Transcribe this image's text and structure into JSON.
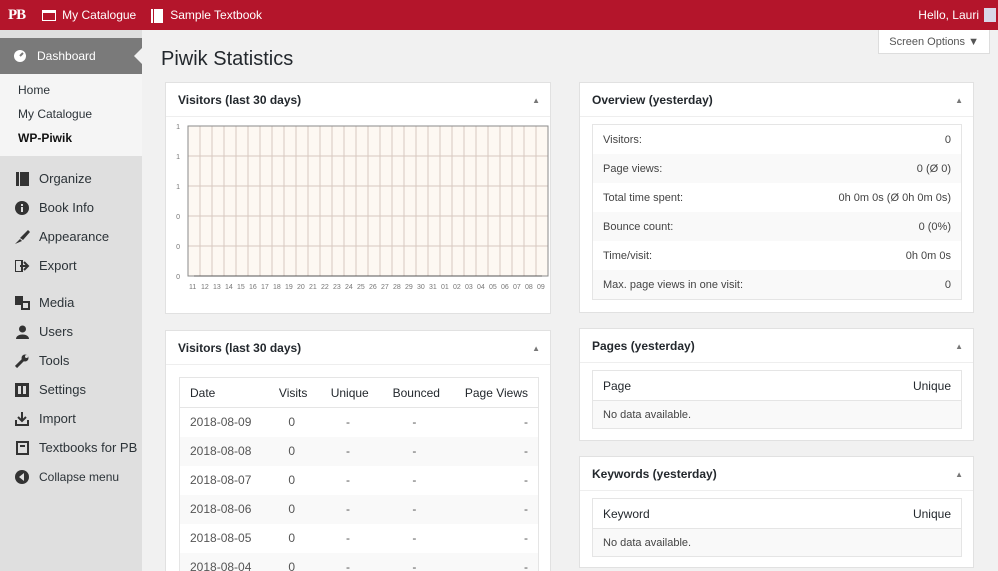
{
  "adminbar": {
    "logo": "PB",
    "catalogue": "My Catalogue",
    "book": "Sample Textbook",
    "greeting": "Hello, Lauri"
  },
  "sidebar": {
    "current": "Dashboard",
    "submenu": [
      "Home",
      "My Catalogue",
      "WP-Piwik"
    ],
    "items": [
      {
        "label": "Organize",
        "icon": "organize-icon"
      },
      {
        "label": "Book Info",
        "icon": "info-icon"
      },
      {
        "label": "Appearance",
        "icon": "appearance-icon"
      },
      {
        "label": "Export",
        "icon": "export-icon"
      },
      {
        "label": "Media",
        "icon": "media-icon"
      },
      {
        "label": "Users",
        "icon": "users-icon"
      },
      {
        "label": "Tools",
        "icon": "tools-icon"
      },
      {
        "label": "Settings",
        "icon": "settings-icon"
      },
      {
        "label": "Import",
        "icon": "import-icon"
      },
      {
        "label": "Textbooks for PB",
        "icon": "textbooks-icon"
      },
      {
        "label": "Collapse menu",
        "icon": "collapse-icon"
      }
    ]
  },
  "page": {
    "title": "Piwik Statistics",
    "screen_options": "Screen Options ▼"
  },
  "chart_box": {
    "title": "Visitors (last 30 days)"
  },
  "chart_data": {
    "type": "line",
    "x": [
      "11",
      "12",
      "13",
      "14",
      "15",
      "16",
      "17",
      "18",
      "19",
      "20",
      "21",
      "22",
      "23",
      "24",
      "25",
      "26",
      "27",
      "28",
      "29",
      "30",
      "31",
      "01",
      "02",
      "03",
      "04",
      "05",
      "06",
      "07",
      "08",
      "09"
    ],
    "series": [
      {
        "values": [
          0,
          0,
          0,
          0,
          0,
          0,
          0,
          0,
          0,
          0,
          0,
          0,
          0,
          0,
          0,
          0,
          0,
          0,
          0,
          0,
          0,
          0,
          0,
          0,
          0,
          0,
          0,
          0,
          0,
          0
        ]
      }
    ],
    "ytick_labels": [
      "1",
      "1",
      "1",
      "0",
      "0",
      "0"
    ],
    "ylim": [
      0,
      1
    ],
    "grid": true
  },
  "table_box": {
    "title": "Visitors (last 30 days)",
    "columns": [
      "Date",
      "Visits",
      "Unique",
      "Bounced",
      "Page Views"
    ],
    "rows": [
      [
        "2018-08-09",
        "0",
        "-",
        "-",
        "-"
      ],
      [
        "2018-08-08",
        "0",
        "-",
        "-",
        "-"
      ],
      [
        "2018-08-07",
        "0",
        "-",
        "-",
        "-"
      ],
      [
        "2018-08-06",
        "0",
        "-",
        "-",
        "-"
      ],
      [
        "2018-08-05",
        "0",
        "-",
        "-",
        "-"
      ],
      [
        "2018-08-04",
        "0",
        "-",
        "-",
        "-"
      ]
    ]
  },
  "overview": {
    "title": "Overview (yesterday)",
    "rows": [
      {
        "label": "Visitors:",
        "value": "0"
      },
      {
        "label": "Page views:",
        "value": "0 (Ø 0)"
      },
      {
        "label": "Total time spent:",
        "value": "0h 0m 0s (Ø 0h 0m 0s)"
      },
      {
        "label": "Bounce count:",
        "value": "0 (0%)"
      },
      {
        "label": "Time/visit:",
        "value": "0h 0m 0s"
      },
      {
        "label": "Max. page views in one visit:",
        "value": "0"
      }
    ]
  },
  "pages": {
    "title": "Pages (yesterday)",
    "col1": "Page",
    "col2": "Unique",
    "empty": "No data available."
  },
  "keywords": {
    "title": "Keywords (yesterday)",
    "col1": "Keyword",
    "col2": "Unique",
    "empty": "No data available."
  },
  "colors": {
    "adminbar": "#b4152b",
    "sidebar": "#dfdfdf",
    "chart_bg": "#fdf8f2",
    "chart_grid": "#d8c8c0"
  }
}
